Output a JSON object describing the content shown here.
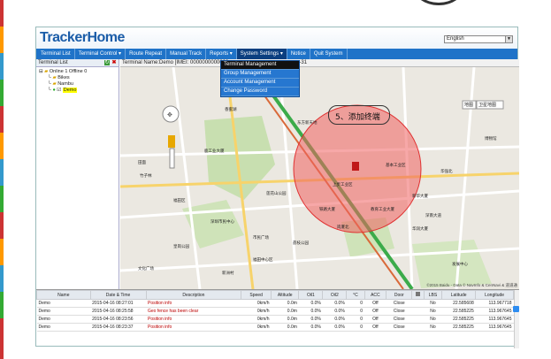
{
  "app": {
    "logo": "TrackerHome",
    "language": "English"
  },
  "nav": [
    {
      "label": "Terminal List"
    },
    {
      "label": "Terminal Control ▾"
    },
    {
      "label": "Route Repeat"
    },
    {
      "label": "Manual Track"
    },
    {
      "label": "Reports ▾"
    },
    {
      "label": "System Settings ▾"
    },
    {
      "label": "Notice"
    },
    {
      "label": "Quit System"
    }
  ],
  "dropdown": [
    {
      "label": "Terminal Management"
    },
    {
      "label": "Group Management"
    },
    {
      "label": "Account Management"
    },
    {
      "label": "Change Password"
    }
  ],
  "sidebar": {
    "title": "Terminal List",
    "tree": {
      "root": "Online 1  Offline 0",
      "group1": "Bikes",
      "group2": "Nambu",
      "device": "Demo"
    }
  },
  "map_header": "Terminal Name:Demo [IMEI: 0000000000000",
  "map_header_tail": "-31",
  "annotation": "5、添加终端",
  "map_labels": {
    "map_toggle": "地图",
    "sat_toggle": "卫星地图",
    "copyright": "©2015 Baidu - Data © NavInfo & CenNavi & 道道通",
    "l1": "博物馆",
    "l2": "鹿工业大厦",
    "l3": "基本工业区",
    "l4": "莲花山公园",
    "l5": "福田区",
    "l6": "深圳市民中心",
    "l7": "皇岗公园",
    "l8": "市民广场",
    "l9": "新洲村",
    "l10": "福田中心区",
    "l11": "岗厦北",
    "l12": "华润大厦",
    "l13": "深南大道",
    "l14": "新华大厦",
    "l15": "东方新天地",
    "l16": "上步工业区",
    "l17": "荔枝公园",
    "l18": "教育工业大厦",
    "l19": "铁路大厦",
    "l20": "华强北",
    "l21": "文化广场",
    "l22": "竹子林",
    "l23": "发展中心",
    "l24": "田面",
    "l25": "香蜜湖"
  },
  "table": {
    "headers": [
      "Name",
      "Date & Time",
      "Description",
      "Speed",
      "Altitude",
      "Oil1",
      "Oil2",
      "°C",
      "ACC",
      "Door",
      "",
      "LBS",
      "Latitude",
      "Longitude"
    ],
    "rows": [
      [
        "Demo",
        "2015-04-16 08:27:01",
        "Position info",
        "0km/h",
        "0.0m",
        "0.0%",
        "0.0%",
        "0",
        "Off",
        "Close",
        "",
        "No",
        "22.585608",
        "113.967718"
      ],
      [
        "Demo",
        "2015-04-16 08:25:58",
        "Geo fence has been clear",
        "0km/h",
        "0.0m",
        "0.0%",
        "0.0%",
        "0",
        "Off",
        "Close",
        "",
        "No",
        "22.585225",
        "113.967645"
      ],
      [
        "Demo",
        "2015-04-16 08:23:56",
        "Position info",
        "0km/h",
        "0.0m",
        "0.0%",
        "0.0%",
        "0",
        "Off",
        "Close",
        "",
        "No",
        "22.585225",
        "113.967645"
      ],
      [
        "Demo",
        "2015-04-16 08:23:37",
        "Position info",
        "0km/h",
        "0.0m",
        "0.0%",
        "0.0%",
        "0",
        "Off",
        "Close",
        "",
        "No",
        "22.585225",
        "113.967645"
      ]
    ]
  },
  "colors": {
    "brand": "#1a5ca8",
    "nav": "#1f73c8",
    "circle": "#f06060"
  }
}
